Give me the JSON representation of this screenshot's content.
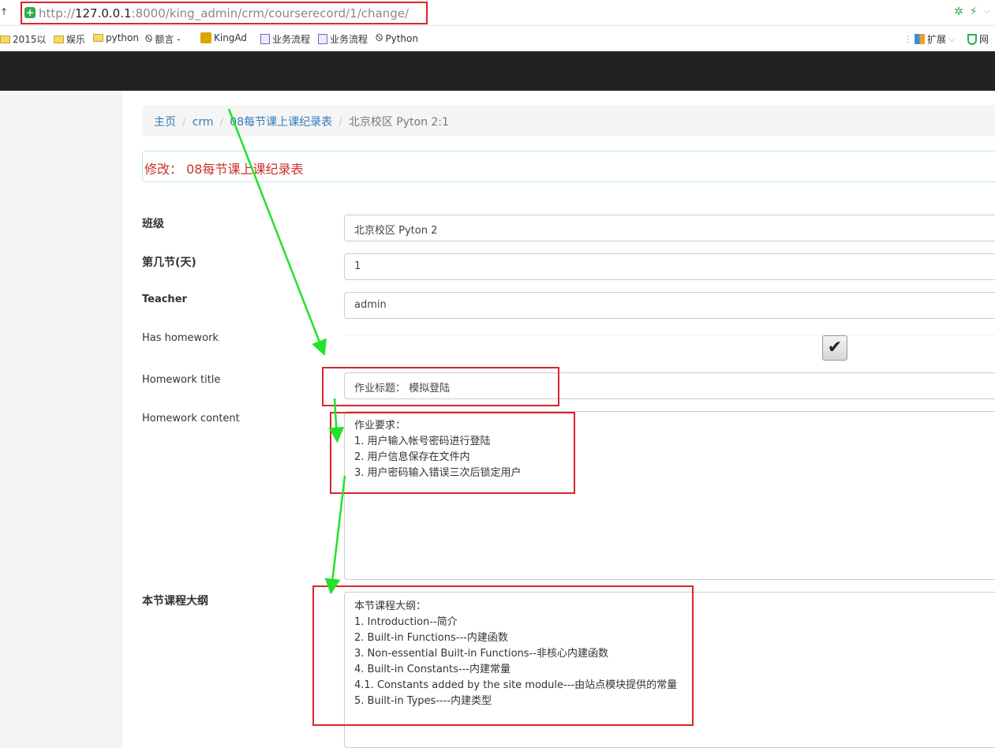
{
  "browser": {
    "back_glyph": "↑",
    "url_prefix": "http://",
    "url_host": "127.0.0.1",
    "url_rest": ":8000/king_admin/crm/courserecord/1/change/",
    "icons": {
      "secure": "plus-shield-icon",
      "sync": "sync-icon",
      "bolt": "lightning-icon"
    }
  },
  "bookmarks": [
    {
      "label": "2015以",
      "icon": "folder-icon"
    },
    {
      "label": "娱乐",
      "icon": "folder-icon"
    },
    {
      "label": "python",
      "icon": "folder-icon"
    },
    {
      "label": "额言 -",
      "icon": "link-icon"
    },
    {
      "label": "KingAd",
      "icon": "kingad-icon"
    },
    {
      "label": "业务流程",
      "icon": "page-icon"
    },
    {
      "label": "业务流程",
      "icon": "page-icon"
    },
    {
      "label": "Python",
      "icon": "link-icon"
    }
  ],
  "bookmarks_right": {
    "extensions": "扩展",
    "net": "网"
  },
  "breadcrumb": {
    "home": "主页",
    "app": "crm",
    "model": "08每节课上课纪录表",
    "current": "北京校区 Pyton 2:1"
  },
  "panel_title": "修改： 08每节课上课纪录表",
  "form": {
    "class_label": "班级",
    "class_value": "北京校区 Pyton 2",
    "day_label": "第几节(天)",
    "day_value": "1",
    "teacher_label": "Teacher",
    "teacher_value": "admin",
    "has_homework_label": "Has homework",
    "has_homework_checked": true,
    "homework_title_label": "Homework title",
    "homework_title_value": "作业标题： 模拟登陆",
    "homework_content_label": "Homework content",
    "homework_content_lines": [
      "作业要求：",
      "1. 用户输入帐号密码进行登陆",
      "2. 用户信息保存在文件内",
      "3. 用户密码输入错误三次后锁定用户"
    ],
    "outline_label": "本节课程大纲",
    "outline_lines": [
      "本节课程大纲：",
      "1. Introduction--简介",
      "2. Built-in Functions---内建函数",
      "3. Non-essential Built-in Functions--非核心内建函数",
      "4. Built-in Constants---内建常量",
      "4.1. Constants added by the site module---由站点模块提供的常量",
      "5. Built-in Types----内建类型"
    ]
  },
  "colors": {
    "annotation_red": "#d8262b",
    "annotation_green": "#22e22a",
    "navbar": "#222222",
    "link": "#337ab7"
  }
}
